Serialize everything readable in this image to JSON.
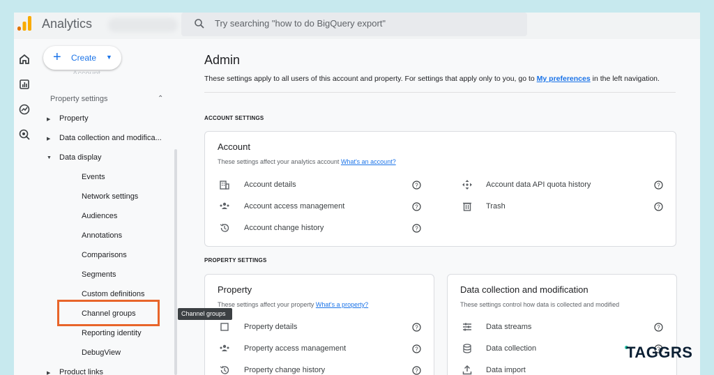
{
  "app": {
    "title": "Analytics"
  },
  "search": {
    "placeholder": "Try searching \"how to do BigQuery export\""
  },
  "nav": {
    "create_label": "Create",
    "ghost_text": "Account",
    "section_label": "Property settings",
    "items": [
      {
        "label": "Property"
      },
      {
        "label": "Data collection and modifica..."
      },
      {
        "label": "Data display"
      },
      {
        "label": "Product links"
      }
    ],
    "sub_items": [
      {
        "label": "Events"
      },
      {
        "label": "Network settings"
      },
      {
        "label": "Audiences"
      },
      {
        "label": "Annotations"
      },
      {
        "label": "Comparisons"
      },
      {
        "label": "Segments"
      },
      {
        "label": "Custom definitions"
      },
      {
        "label": "Channel groups"
      },
      {
        "label": "Reporting identity"
      },
      {
        "label": "DebugView"
      }
    ],
    "tooltip": "Channel groups"
  },
  "main": {
    "title": "Admin",
    "intro_text": "These settings apply to all users of this account and property. For settings that apply only to you, go to ",
    "intro_link": "My preferences",
    "intro_suffix": " in the left navigation.",
    "account_section": "ACCOUNT SETTINGS",
    "property_section": "PROPERTY SETTINGS",
    "account_card": {
      "title": "Account",
      "desc": "These settings affect your analytics account ",
      "desc_link": "What's an account?",
      "rows": [
        {
          "label": "Account details",
          "icon": "building-icon"
        },
        {
          "label": "Account access management",
          "icon": "people-icon"
        },
        {
          "label": "Account change history",
          "icon": "history-icon"
        },
        {
          "label": "Account data API quota history",
          "icon": "move-arrows-icon"
        },
        {
          "label": "Trash",
          "icon": "trash-icon"
        }
      ]
    },
    "property_card": {
      "title": "Property",
      "desc": "These settings affect your property ",
      "desc_link": "What's a property?",
      "rows": [
        {
          "label": "Property details",
          "icon": "property-icon"
        },
        {
          "label": "Property access management",
          "icon": "people-icon"
        },
        {
          "label": "Property change history",
          "icon": "history-icon"
        }
      ]
    },
    "data_card": {
      "title": "Data collection and modification",
      "desc": "These settings control how data is collected and modified",
      "rows": [
        {
          "label": "Data streams",
          "icon": "streams-icon"
        },
        {
          "label": "Data collection",
          "icon": "database-icon"
        },
        {
          "label": "Data import",
          "icon": "upload-icon"
        }
      ]
    }
  },
  "brand": {
    "text": "TAGGRS"
  },
  "colors": {
    "accent": "#1a73e8",
    "highlight": "#e8652a",
    "logo_orange": "#f9ab00",
    "logo_dark": "#e37400"
  }
}
